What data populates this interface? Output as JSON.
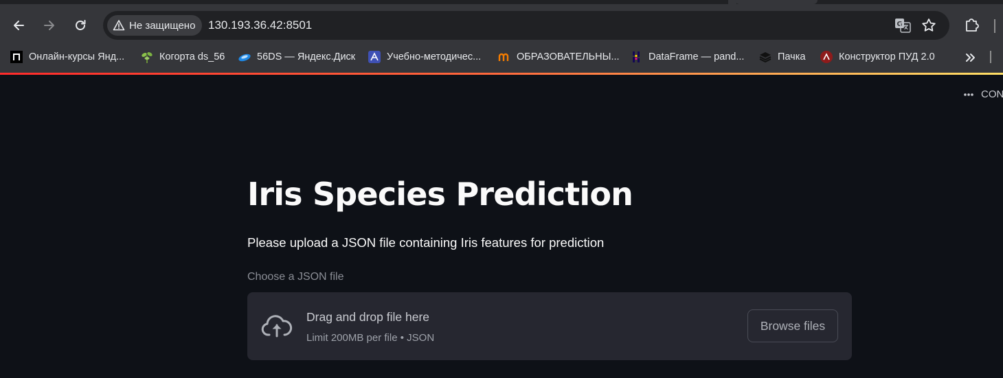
{
  "browser": {
    "security_label": "Не защищено",
    "url": "130.193.36.42:8501",
    "bookmarks": [
      {
        "label": "Онлайн-курсы Янд...",
        "icon": "practicum-icon"
      },
      {
        "label": "Когорта ds_56",
        "icon": "plant-icon"
      },
      {
        "label": "56DS — Яндекс.Диск",
        "icon": "yandex-disk-icon"
      },
      {
        "label": "Учебно-методичес...",
        "icon": "university-icon"
      },
      {
        "label": "ОБРАЗОВАТЕЛЬНЫ...",
        "icon": "edu-portal-icon"
      },
      {
        "label": "DataFrame — pand...",
        "icon": "pandas-icon"
      },
      {
        "label": "Пачка",
        "icon": "stack-icon"
      },
      {
        "label": "Конструктор ПУД 2.0",
        "icon": "constructor-icon"
      }
    ]
  },
  "app": {
    "menu_label": "CON",
    "title": "Iris Species Prediction",
    "subtitle": "Please upload a JSON file containing Iris features for prediction",
    "uploader": {
      "label": "Choose a JSON file",
      "drop_title": "Drag and drop file here",
      "limit_text": "Limit 200MB per file • JSON",
      "browse_label": "Browse files"
    }
  },
  "colors": {
    "app_background": "#0e1117",
    "dropzone_background": "#262730",
    "chrome_toolbar": "#35363a",
    "accent_gradient_start": "#ff2b2b",
    "accent_gradient_end": "#ffe066"
  }
}
